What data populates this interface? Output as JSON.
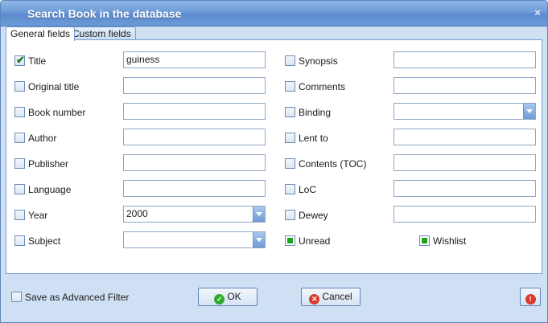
{
  "window": {
    "title": "Search Book in the database",
    "close_glyph": "×"
  },
  "tabs": [
    {
      "label": "General fields"
    },
    {
      "label": "Custom fields"
    }
  ],
  "left_fields": [
    {
      "label": "Title",
      "checked": true,
      "value": "guiness",
      "type": "text"
    },
    {
      "label": "Original title",
      "checked": false,
      "value": "",
      "type": "text"
    },
    {
      "label": "Book number",
      "checked": false,
      "value": "",
      "type": "text"
    },
    {
      "label": "Author",
      "checked": false,
      "value": "",
      "type": "text"
    },
    {
      "label": "Publisher",
      "checked": false,
      "value": "",
      "type": "text"
    },
    {
      "label": "Language",
      "checked": false,
      "value": "",
      "type": "text"
    },
    {
      "label": "Year",
      "checked": false,
      "value": "2000",
      "type": "combo"
    },
    {
      "label": "Subject",
      "checked": false,
      "value": "",
      "type": "combo"
    }
  ],
  "right_fields": [
    {
      "label": "Synopsis",
      "checked": false,
      "value": "",
      "type": "text"
    },
    {
      "label": "Comments",
      "checked": false,
      "value": "",
      "type": "text"
    },
    {
      "label": "Binding",
      "checked": false,
      "value": "",
      "type": "combo"
    },
    {
      "label": "Lent to",
      "checked": false,
      "value": "",
      "type": "text"
    },
    {
      "label": "Contents (TOC)",
      "checked": false,
      "value": "",
      "type": "text"
    },
    {
      "label": "LoC",
      "checked": false,
      "value": "",
      "type": "text"
    },
    {
      "label": "Dewey",
      "checked": false,
      "value": "",
      "type": "text"
    }
  ],
  "toggles": {
    "unread": "Unread",
    "wishlist": "Wishlist"
  },
  "footer": {
    "save_filter_label": "Save as Advanced Filter",
    "ok_label": "OK",
    "cancel_label": "Cancel",
    "ok_icon": "check-icon",
    "cancel_icon": "x-circle-icon",
    "help_icon": "alert-icon"
  },
  "colors": {
    "accent": "#5b8bcf",
    "ok": "#2eaa2e",
    "cancel": "#d83a2a",
    "toggle_green": "#1aa51a"
  }
}
